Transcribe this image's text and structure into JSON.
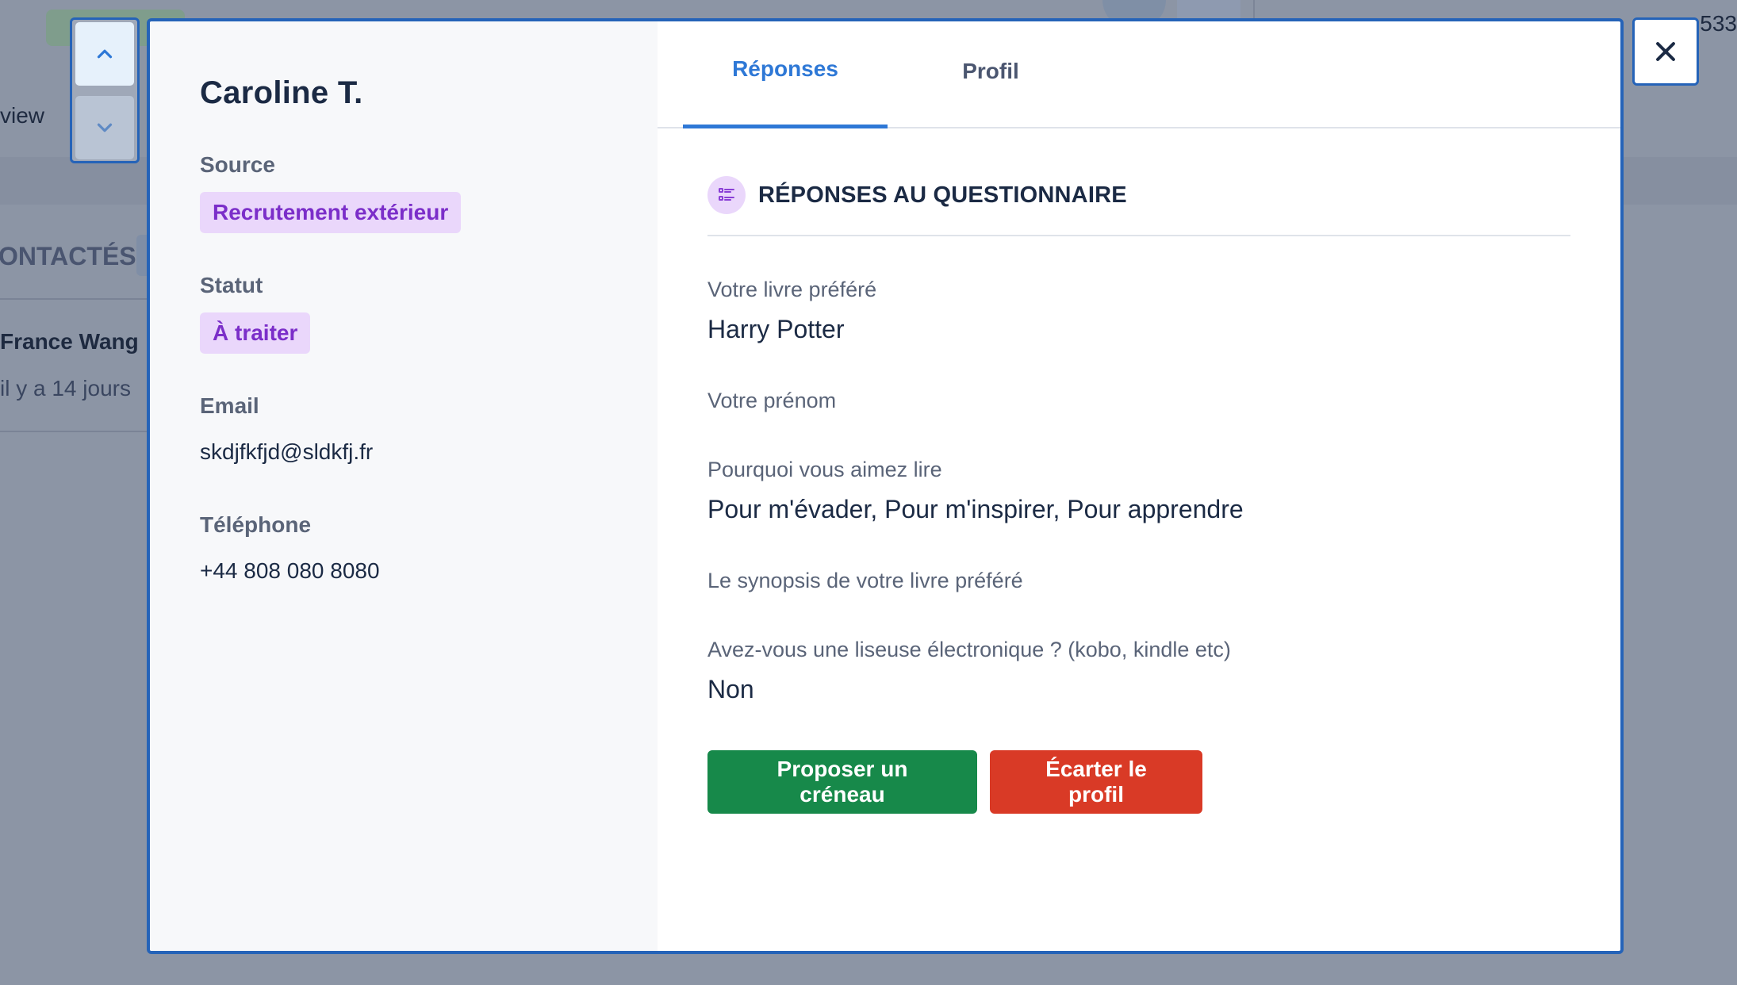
{
  "background": {
    "left_partial_view": "view",
    "left_partial_section": "ONTACTÉS",
    "left_partial_name": "France Wang",
    "left_partial_time": "il y a 14 jours",
    "top_right_partial": "533"
  },
  "nav": {
    "up_icon": "chevron-up-icon",
    "down_icon": "chevron-down-icon"
  },
  "close_icon": "close-icon",
  "candidate": {
    "name": "Caroline T.",
    "source_label": "Source",
    "source_value": "Recrutement extérieur",
    "status_label": "Statut",
    "status_value": "À traiter",
    "email_label": "Email",
    "email_value": "skdjfkfjd@sldkfj.fr",
    "phone_label": "Téléphone",
    "phone_value": "+44 808 080 8080"
  },
  "tabs": {
    "reponses": "Réponses",
    "profil": "Profil",
    "active": "reponses"
  },
  "section": {
    "title": "RÉPONSES AU QUESTIONNAIRE",
    "icon": "list-icon"
  },
  "questions": [
    {
      "q": "Votre livre préféré",
      "a": "Harry Potter"
    },
    {
      "q": "Votre prénom",
      "a": ""
    },
    {
      "q": "Pourquoi vous aimez lire",
      "a": "Pour m'évader, Pour m'inspirer, Pour apprendre"
    },
    {
      "q": "Le synopsis de votre livre préféré",
      "a": ""
    },
    {
      "q": "Avez-vous une liseuse électronique ? (kobo, kindle etc)",
      "a": "Non"
    }
  ],
  "actions": {
    "propose": "Proposer un créneau",
    "reject": "Écarter le profil"
  },
  "colors": {
    "accent": "#2e78d6",
    "modal_border": "#2563b8",
    "pill_bg": "#ead7fb",
    "pill_text": "#7b2ec9",
    "green": "#17894a",
    "red": "#d93a26",
    "overlay": "#8c95a5"
  }
}
